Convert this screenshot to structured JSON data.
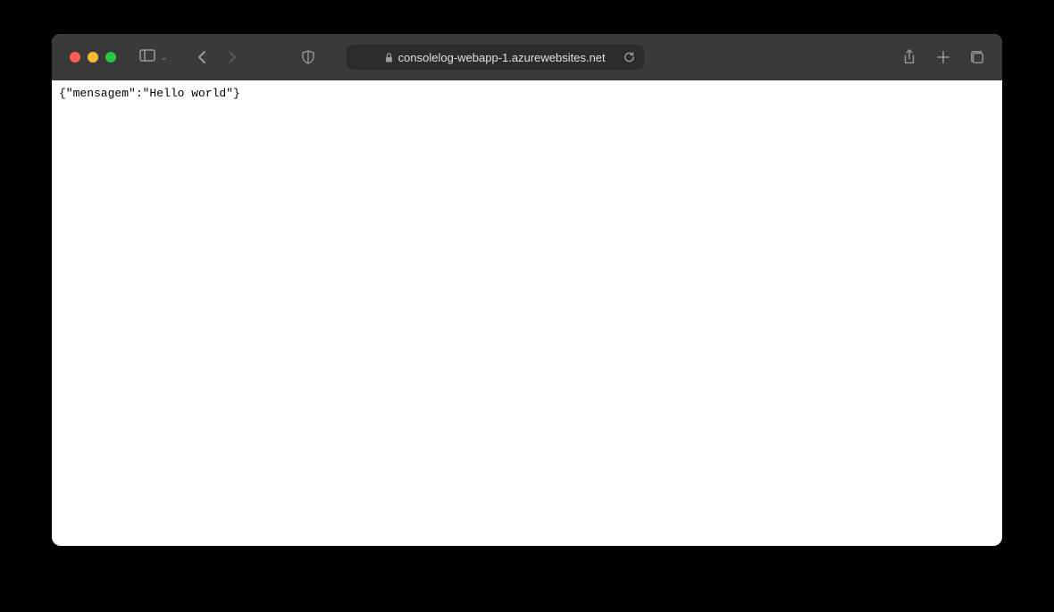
{
  "toolbar": {
    "url": "consolelog-webapp-1.azurewebsites.net"
  },
  "content": {
    "body": "{\"mensagem\":\"Hello world\"}"
  }
}
